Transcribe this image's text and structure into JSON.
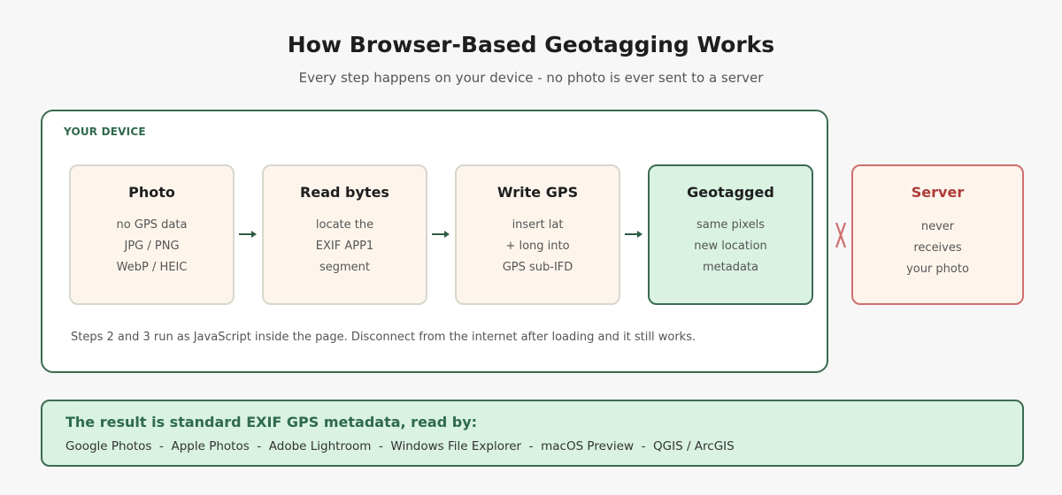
{
  "header": {
    "title": "How Browser-Based Geotagging Works",
    "subtitle": "Every step happens on your device - no photo is ever sent to a server"
  },
  "device": {
    "label": "YOUR DEVICE",
    "note": "Steps 2 and 3 run as JavaScript inside the page. Disconnect from the internet after loading and it still works."
  },
  "steps": [
    {
      "title": "Photo",
      "lines": [
        "no GPS data",
        "JPG / PNG",
        "WebP / HEIC"
      ]
    },
    {
      "title": "Read bytes",
      "lines": [
        "locate the",
        "EXIF APP1",
        "segment"
      ]
    },
    {
      "title": "Write GPS",
      "lines": [
        "insert lat",
        "+ long into",
        "GPS sub-IFD"
      ]
    },
    {
      "title": "Geotagged",
      "lines": [
        "same pixels",
        "new location",
        "metadata"
      ]
    }
  ],
  "server": {
    "title": "Server",
    "lines": [
      "never",
      "receives",
      "your photo"
    ]
  },
  "result": {
    "title": "The result is standard EXIF GPS metadata, read by:",
    "apps": "Google Photos  -  Apple Photos  -  Adobe Lightroom  -  Windows File Explorer  -  macOS Preview  -  QGIS / ArcGIS"
  },
  "colors": {
    "accent_green": "#3d6b52",
    "final_fill": "#d9f2e2",
    "step_fill": "#fdf5ec",
    "server_red": "#cf6f6f"
  },
  "icons": {
    "arrow": "right-arrow-icon",
    "block": "blocked-connection-icon"
  }
}
